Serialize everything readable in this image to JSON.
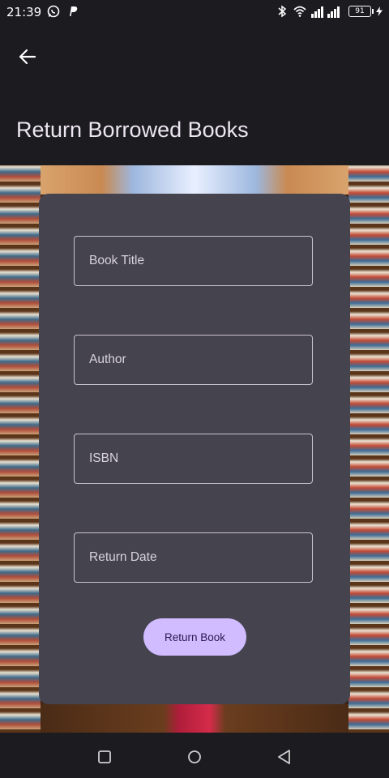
{
  "status_bar": {
    "time": "21:39",
    "battery": "91",
    "left_icons": [
      "whatsapp-icon",
      "parking-icon"
    ],
    "right_icons": [
      "bluetooth-icon",
      "wifi-icon",
      "signal-icon",
      "battery-icon"
    ]
  },
  "app_bar": {
    "back_icon": "arrow-left-icon",
    "title": "Return Borrowed Books"
  },
  "form": {
    "fields": [
      {
        "label": "Book Title",
        "value": ""
      },
      {
        "label": "Author",
        "value": ""
      },
      {
        "label": "ISBN",
        "value": ""
      },
      {
        "label": "Return Date",
        "value": ""
      }
    ],
    "submit_label": "Return Book"
  },
  "nav_bar": {
    "buttons": [
      "recents-icon",
      "home-icon",
      "back-triangle-icon"
    ]
  },
  "colors": {
    "background": "#1c1b20",
    "card": "#45434e",
    "button": "#d0bcff",
    "button_text": "#2b1a4f",
    "outline": "#cac4d0"
  }
}
